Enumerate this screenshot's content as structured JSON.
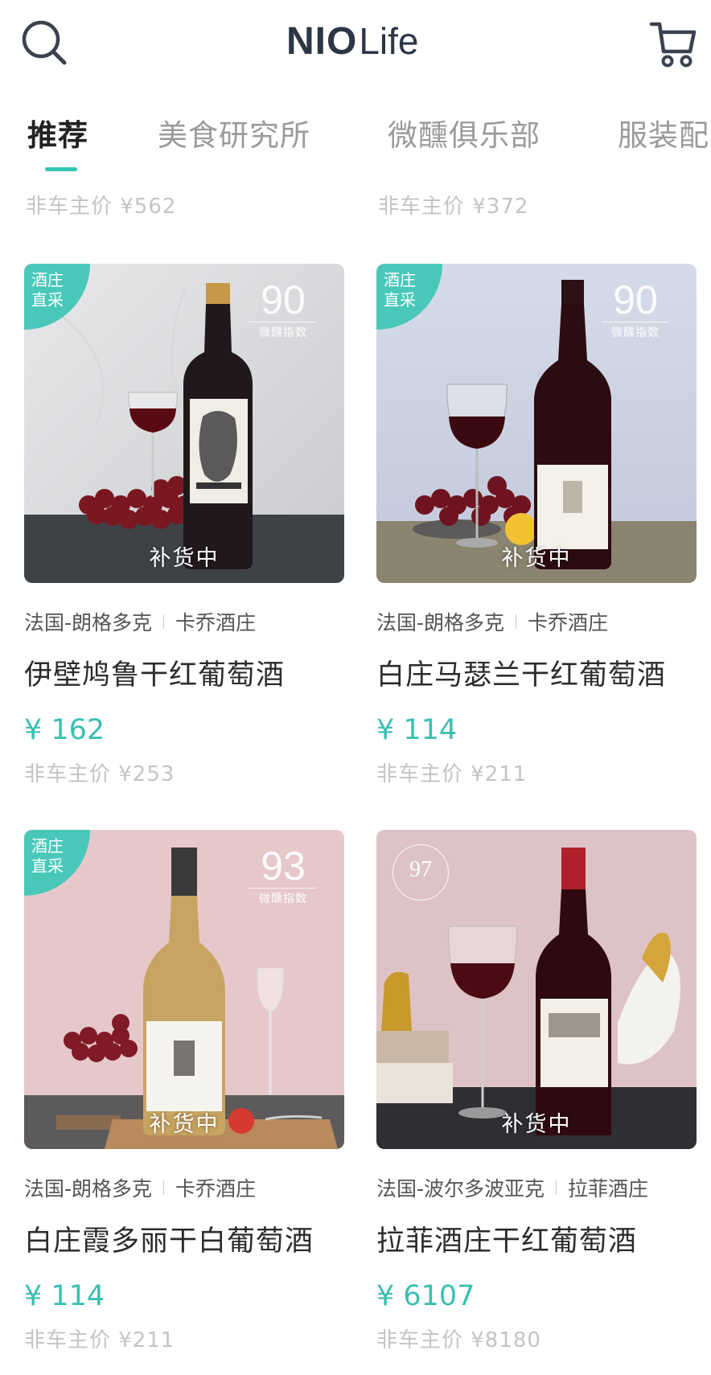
{
  "header": {
    "logo_bold": "NIO",
    "logo_light": "Life"
  },
  "tabs": [
    {
      "label": "推荐",
      "active": true
    },
    {
      "label": "美食研究所",
      "active": false
    },
    {
      "label": "微醺俱乐部",
      "active": false
    },
    {
      "label": "服装配",
      "active": false
    }
  ],
  "previous_row": [
    {
      "member_price": "非车主价 ¥562"
    },
    {
      "member_price": "非车主价 ¥372"
    }
  ],
  "products": [
    {
      "badge_line1": "酒庄",
      "badge_line2": "直采",
      "score": "90",
      "score_label": "微醺指数",
      "stock_status": "补货中",
      "region": "法国-朗格多克",
      "winery": "卡乔酒庄",
      "name": "伊壁鸠鲁干红葡萄酒",
      "price": "¥ 162",
      "member_price": "非车主价 ¥253"
    },
    {
      "badge_line1": "酒庄",
      "badge_line2": "直采",
      "score": "90",
      "score_label": "微醺指数",
      "stock_status": "补货中",
      "region": "法国-朗格多克",
      "winery": "卡乔酒庄",
      "name": "白庄马瑟兰干红葡萄酒",
      "price": "¥ 114",
      "member_price": "非车主价 ¥211"
    },
    {
      "badge_line1": "酒庄",
      "badge_line2": "直采",
      "score": "93",
      "score_label": "微醺指数",
      "stock_status": "补货中",
      "region": "法国-朗格多克",
      "winery": "卡乔酒庄",
      "name": "白庄霞多丽干白葡萄酒",
      "price": "¥ 114",
      "member_price": "非车主价 ¥211"
    },
    {
      "seal_score": "97",
      "stock_status": "补货中",
      "region": "法国-波尔多波亚克",
      "winery": "拉菲酒庄",
      "name": "拉菲酒庄干红葡萄酒",
      "price": "¥ 6107",
      "member_price": "非车主价 ¥8180"
    }
  ],
  "colors": {
    "accent": "#3bbfb0",
    "badge": "#49c8ba",
    "logo": "#2d3645"
  }
}
